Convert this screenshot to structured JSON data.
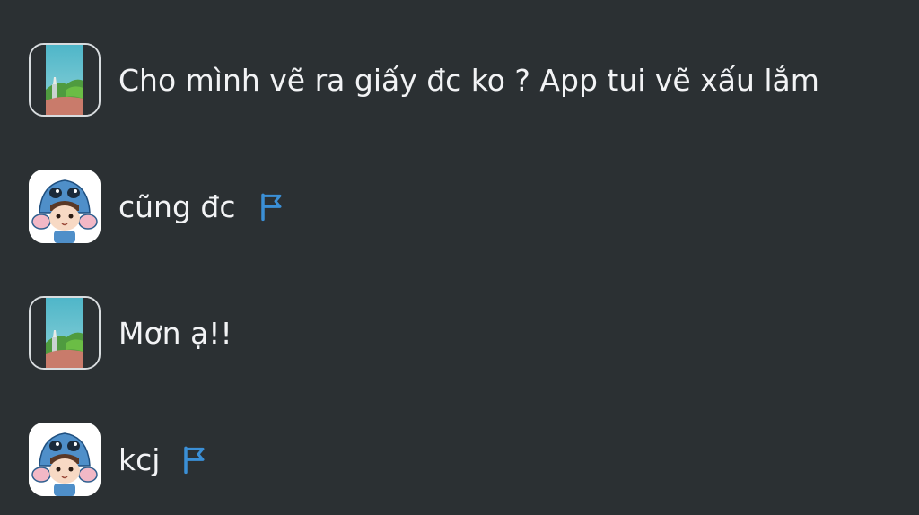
{
  "messages": [
    {
      "avatar": "scenic-avatar",
      "text": "Cho mình vẽ ra giấy đc ko ? App tui vẽ xấu lắm",
      "flag": false
    },
    {
      "avatar": "cartoon-avatar",
      "text": "cũng đc",
      "flag": true
    },
    {
      "avatar": "scenic-avatar",
      "text": "Mơn ạ!!",
      "flag": false
    },
    {
      "avatar": "cartoon-avatar",
      "text": "kcj",
      "flag": true
    }
  ],
  "colors": {
    "background": "#2b3033",
    "text": "#f2f3f5",
    "flag": "#3b8fd6",
    "avatar_border": "#d8dcdf"
  },
  "icons": {
    "flag": "flag-icon"
  }
}
